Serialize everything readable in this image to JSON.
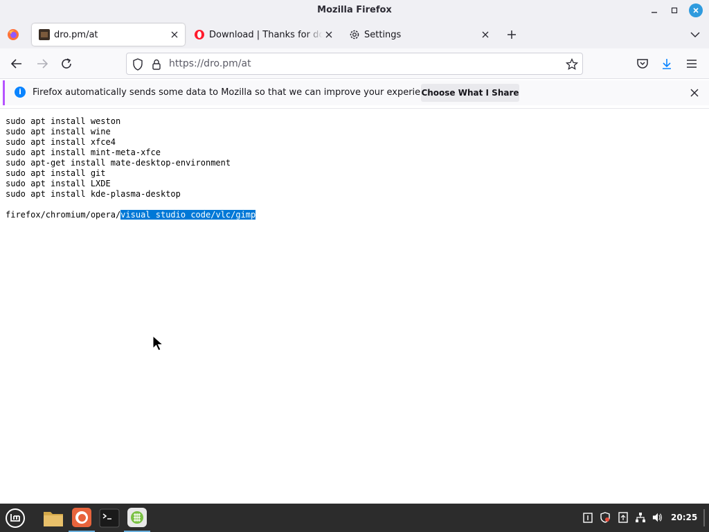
{
  "window": {
    "title": "Mozilla Firefox"
  },
  "tabs": [
    {
      "label": "dro.pm/at",
      "active": true
    },
    {
      "label": "Download | Thanks for downloading",
      "active": false
    },
    {
      "label": "Settings",
      "active": false
    }
  ],
  "nav": {
    "url": "https://dro.pm/at"
  },
  "notification": {
    "message": "Firefox automatically sends some data to Mozilla so that we can improve your experience.",
    "button": "Choose What I Share"
  },
  "content": {
    "lines": [
      "sudo apt install weston",
      "sudo apt install wine",
      "sudo apt install xfce4",
      "sudo apt install mint-meta-xfce",
      "sudo apt-get install mate-desktop-environment",
      "sudo apt install git",
      "sudo apt install LXDE",
      "sudo apt install kde-plasma-desktop"
    ],
    "browsers_plain": "firefox/chromium/opera/",
    "browsers_selected": "visual studio code/vlc/gimp"
  },
  "taskbar": {
    "clock": "20:25"
  },
  "colors": {
    "accent": "#0a84ff",
    "selection": "#0078d7",
    "taskbar": "#2c2c2c"
  },
  "icons": [
    "firefox-logo-icon",
    "minimize-icon",
    "maximize-icon",
    "close-icon",
    "back-icon",
    "forward-icon",
    "reload-icon",
    "shield-icon",
    "lock-icon",
    "bookmark-star-icon",
    "pocket-icon",
    "download-icon",
    "menu-icon",
    "info-icon",
    "mint-menu-icon",
    "files-icon",
    "terminal-icon",
    "app-icon"
  ]
}
